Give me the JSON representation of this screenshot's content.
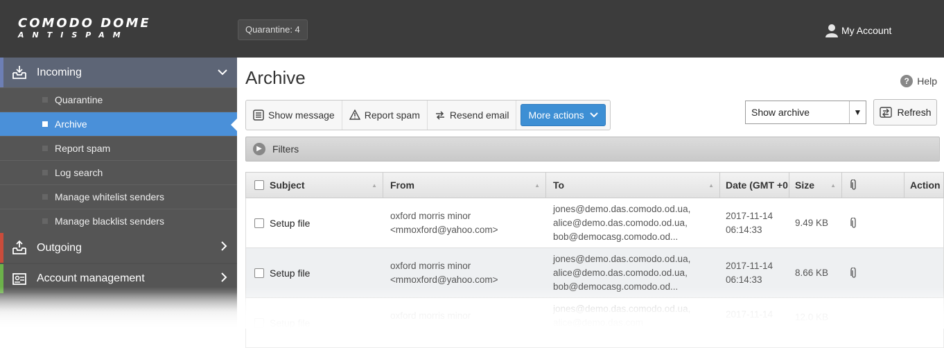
{
  "header": {
    "logo_line1": "COMODO DOME",
    "logo_line2": "ANTISPAM",
    "quarantine_label": "Quarantine: 4",
    "account_label": "My Account"
  },
  "sidebar": {
    "incoming": "Incoming",
    "sub_items": [
      "Quarantine",
      "Archive",
      "Report spam",
      "Log search",
      "Manage whitelist senders",
      "Manage blacklist senders"
    ],
    "active_index": 1,
    "outgoing": "Outgoing",
    "account_management": "Account management"
  },
  "main": {
    "title": "Archive",
    "help_label": "Help",
    "toolbar": {
      "show_message": "Show message",
      "report_spam": "Report spam",
      "resend_email": "Resend email",
      "more_actions": "More actions"
    },
    "select_value": "Show archive",
    "refresh_label": "Refresh",
    "filters_label": "Filters"
  },
  "table": {
    "headers": [
      "Subject",
      "From",
      "To",
      "Date (GMT +0",
      "Size",
      "",
      "Action"
    ],
    "rows": [
      {
        "subject": "Setup file",
        "from_name": "oxford morris minor",
        "from_email": "<mmoxford@yahoo.com>",
        "to_1": "jones@demo.das.comodo.od.ua,",
        "to_2": "alice@demo.das.comodo.od.ua,",
        "to_3": "bob@democasg.comodo.od...",
        "date": "2017-11-14",
        "time": "06:14:33",
        "size": "9.49 KB",
        "attachment": true
      },
      {
        "subject": "Setup file",
        "from_name": "oxford morris minor",
        "from_email": "<mmoxford@yahoo.com>",
        "to_1": "jones@demo.das.comodo.od.ua,",
        "to_2": "alice@demo.das.comodo.od.ua,",
        "to_3": "bob@democasg.comodo.od...",
        "date": "2017-11-14",
        "time": "06:14:33",
        "size": "8.66 KB",
        "attachment": true
      },
      {
        "subject": "Setup file",
        "from_name": "oxford morris minor",
        "from_email": "",
        "to_1": "jones@demo.das.comodo.od.ua,",
        "to_2": "alice@demo.das.com",
        "to_3": "",
        "date": "2017-11-14",
        "time": "",
        "size": "12.0 KB",
        "attachment": false
      }
    ]
  },
  "colors": {
    "topbar": "#3c3c3c",
    "sidebar": "#505050",
    "active_item": "#4a90d9",
    "primary_button": "#3d8fd4"
  }
}
